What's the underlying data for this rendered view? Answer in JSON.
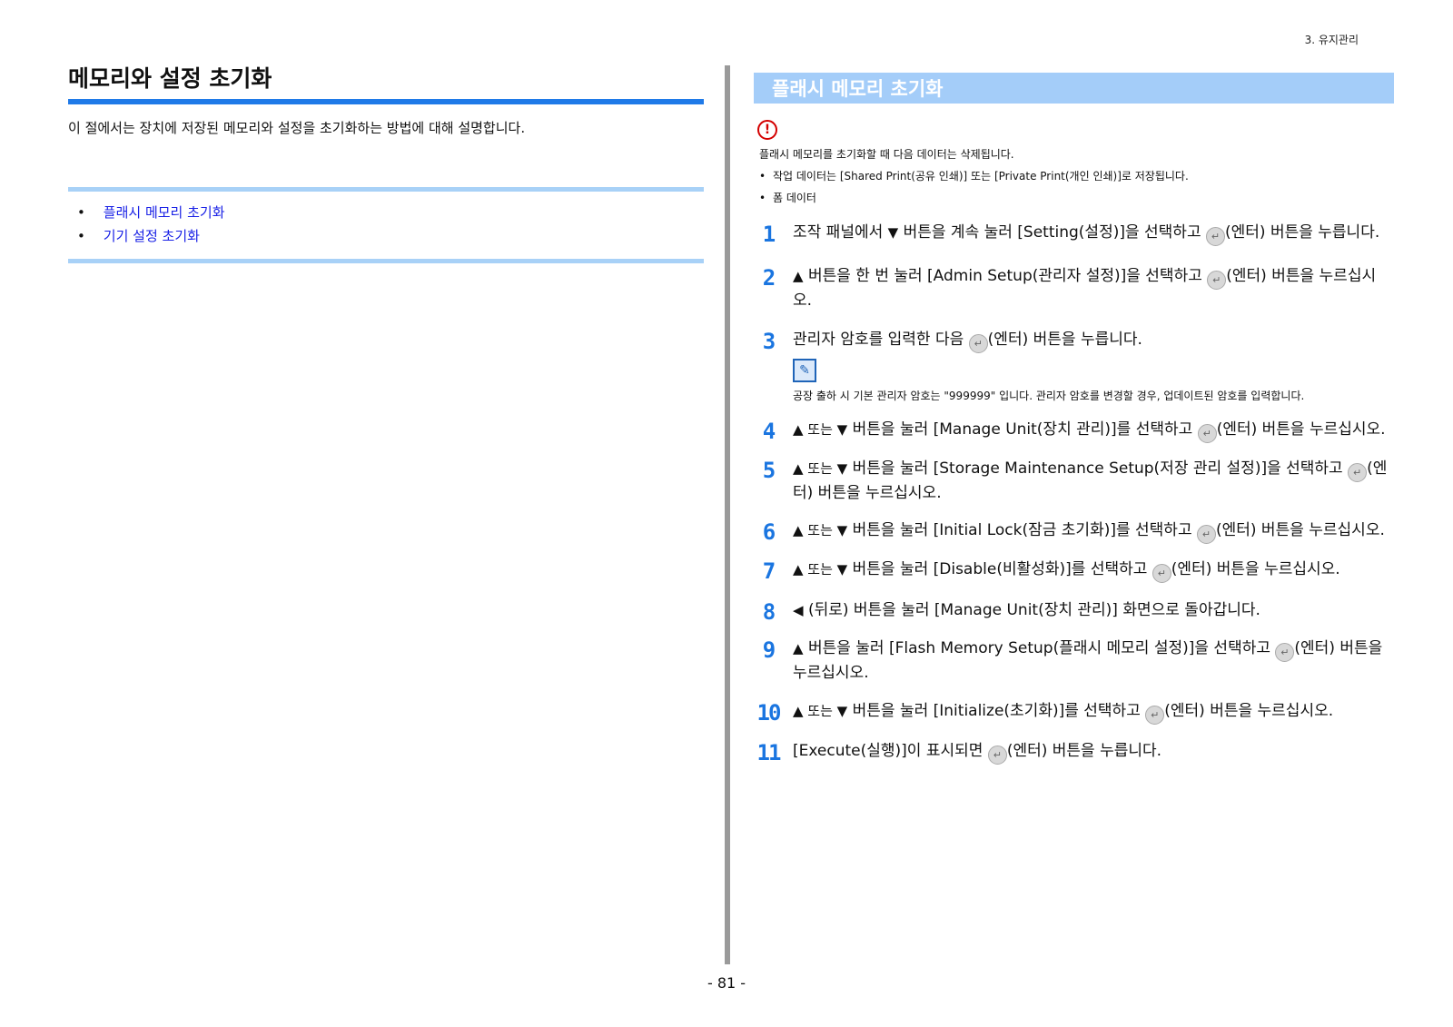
{
  "header": {
    "chapter": "3. 유지관리"
  },
  "left": {
    "title": "메모리와 설정 초기화",
    "intro": "이 절에서는 장치에 저장된 메모리와 설정을 초기화하는 방법에 대해 설명합니다.",
    "toc": [
      {
        "bullet": "•",
        "label": "플래시 메모리 초기화"
      },
      {
        "bullet": "•",
        "label": "기기 설정 초기화"
      }
    ]
  },
  "right": {
    "section_title": "플래시 메모리 초기화",
    "warning": {
      "icon": "!",
      "text": "플래시 메모리를 초기화할 때 다음 데이터는 삭제됩니다.",
      "bullets": [
        "작업 데이터는 [Shared Print(공유 인쇄)] 또는 [Private Print(개인 인쇄)]로 저장됩니다.",
        "폼 데이터"
      ]
    },
    "steps": [
      {
        "num": "1",
        "pre": "조작 패널에서",
        "tri": "▼",
        "mid": "버튼을 계속 눌러 [Setting(설정)]을 선택하고",
        "post": "(엔터) 버튼을 누릅니다."
      },
      {
        "num": "2",
        "pre": "",
        "tri": "▲",
        "mid": "버튼을 한 번 눌러 [Admin Setup(관리자 설정)]을 선택하고",
        "post": "(엔터) 버튼을 누르십시오."
      },
      {
        "num": "3",
        "pre": "관리자 암호를 입력한 다음",
        "tri": "",
        "mid": "",
        "post": "(엔터) 버튼을 누릅니다."
      },
      {
        "num": "4",
        "pre": "",
        "tri": "▲ 또는 ▼",
        "mid": "버튼을 눌러 [Manage Unit(장치 관리)]를 선택하고",
        "post": "(엔터) 버튼을 누르십시오."
      },
      {
        "num": "5",
        "pre": "",
        "tri": "▲ 또는 ▼",
        "mid": "버튼을 눌러 [Storage Maintenance Setup(저장 관리 설정)]을 선택하고",
        "post": "(엔터) 버튼을 누르십시오."
      },
      {
        "num": "6",
        "pre": "",
        "tri": "▲ 또는 ▼",
        "mid": "버튼을 눌러 [Initial Lock(잠금 초기화)]를 선택하고",
        "post": "(엔터) 버튼을 누르십시오."
      },
      {
        "num": "7",
        "pre": "",
        "tri": "▲ 또는 ▼",
        "mid": "버튼을 눌러 [Disable(비활성화)]를 선택하고",
        "post": "(엔터) 버튼을 누르십시오."
      },
      {
        "num": "8",
        "pre": "",
        "tri": "◀",
        "mid": "(뒤로) 버튼을 눌러 [Manage Unit(장치 관리)] 화면으로 돌아갑니다.",
        "post": ""
      },
      {
        "num": "9",
        "pre": "",
        "tri": "▲",
        "mid": "버튼을 눌러 [Flash Memory Setup(플래시 메모리 설정)]을 선택하고",
        "post": "(엔터) 버튼을 누르십시오."
      },
      {
        "num": "10",
        "pre": "",
        "tri": "▲ 또는 ▼",
        "mid": "버튼을 눌러 [Initialize(초기화)]를 선택하고",
        "post": "(엔터) 버튼을 누르십시오."
      },
      {
        "num": "11",
        "pre": "[Execute(실행)]이 표시되면",
        "tri": "",
        "mid": "",
        "post": "(엔터) 버튼을 누릅니다."
      }
    ],
    "memo": {
      "icon": "✎",
      "text": "공장 출하 시 기본 관리자 암호는 \"999999\" 입니다. 관리자 암호를 변경할 경우, 업데이트된 암호를 입력합니다."
    }
  },
  "footer": {
    "page": "- 81 -"
  },
  "colors": {
    "accent": "#1f7ae8",
    "section_bar": "#a4cdf9",
    "link": "#1a22e6",
    "warning": "#d40000"
  }
}
